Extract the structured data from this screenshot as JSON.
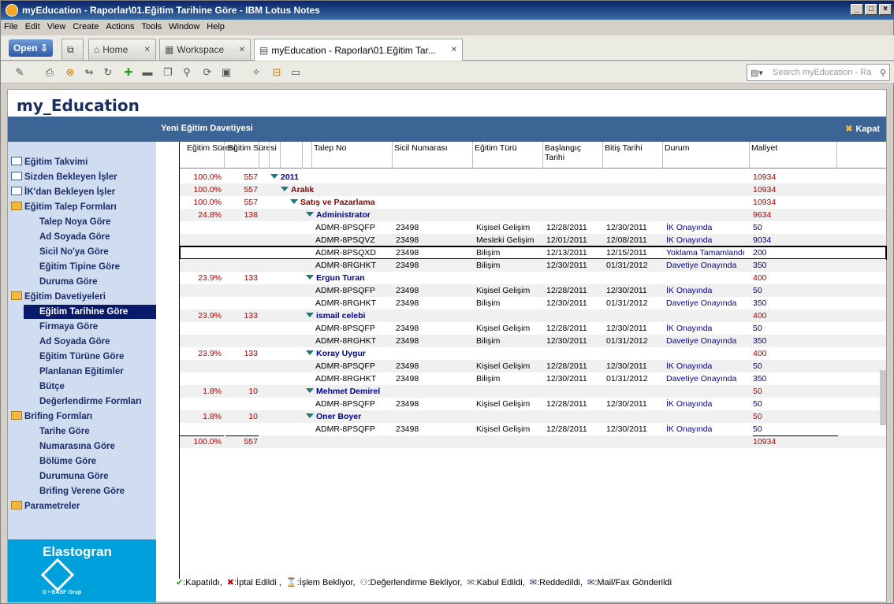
{
  "window": {
    "title": "myEducation - Raporlar\\01.Eğitim Tarihine Göre - IBM Lotus Notes",
    "controls": [
      "_",
      "□",
      "×"
    ]
  },
  "menu": [
    "File",
    "Edit",
    "View",
    "Create",
    "Actions",
    "Tools",
    "Window",
    "Help"
  ],
  "tabs": {
    "open": "Open",
    "home": "Home",
    "workspace": "Workspace",
    "active": "myEducation - Raporlar\\01.Eğitim Tar..."
  },
  "search": {
    "placeholder": "Search myEducation - Ra"
  },
  "app": {
    "title": "my_Education",
    "action_title": "Yeni Eğitim Davetiyesi",
    "close": "Kapat"
  },
  "sidebar": [
    {
      "label": "Eğitim Takvimi",
      "type": "table"
    },
    {
      "label": "Sizden Bekleyen İşler",
      "type": "table"
    },
    {
      "label": "İK'dan Bekleyen İşler",
      "type": "table"
    },
    {
      "label": "Eğitim Talep Formları",
      "type": "folder"
    },
    {
      "label": "Talep Noya Göre",
      "type": "sub"
    },
    {
      "label": "Ad Soyada Göre",
      "type": "sub"
    },
    {
      "label": "Sicil No'ya Göre",
      "type": "sub"
    },
    {
      "label": "Eğitim Tipine Göre",
      "type": "sub"
    },
    {
      "label": "Duruma Göre",
      "type": "sub"
    },
    {
      "label": "Eğitim Davetiyeleri",
      "type": "folder"
    },
    {
      "label": "Eğitim Tarihine Göre",
      "type": "selected"
    },
    {
      "label": "Firmaya Göre",
      "type": "sub"
    },
    {
      "label": "Ad Soyada Göre",
      "type": "sub"
    },
    {
      "label": "Eğitim Türüne Göre",
      "type": "sub"
    },
    {
      "label": "Planlanan Eğitimler",
      "type": "sub"
    },
    {
      "label": "Bütçe",
      "type": "sub"
    },
    {
      "label": "Değerlendirme Formları",
      "type": "sub"
    },
    {
      "label": "Brifing Formları",
      "type": "folder"
    },
    {
      "label": "Tarihe Göre",
      "type": "sub"
    },
    {
      "label": "Numarasına Göre",
      "type": "sub"
    },
    {
      "label": "Bölüme Göre",
      "type": "sub"
    },
    {
      "label": "Durumuna Göre",
      "type": "sub"
    },
    {
      "label": "Brifing Verene Göre",
      "type": "sub"
    },
    {
      "label": "Parametreler",
      "type": "folder"
    }
  ],
  "brand": {
    "name": "Elastogran",
    "group": "D • BASF Grup"
  },
  "columns": {
    "egitim_suresi_1": "Eğitim Süresi",
    "egitim_suresi_2": "Eğitim Süresi",
    "talep_no": "Talep No",
    "sicil": "Sicil Numarası",
    "egitim_turu": "Eğitim Türü",
    "baslangic": "Başlangıç Tarihi",
    "bitis": "Bitiş Tarihi",
    "durum": "Durum",
    "maliyet": "Maliyet"
  },
  "rows": [
    {
      "kind": "cat",
      "level": 0,
      "pct": "100.0%",
      "num": "557",
      "label": "2011",
      "cost": "10934"
    },
    {
      "kind": "cat",
      "level": 1,
      "pct": "100.0%",
      "num": "557",
      "label": "Aralık",
      "cost": "10934"
    },
    {
      "kind": "cat",
      "level": 2,
      "pct": "100.0%",
      "num": "557",
      "label": "Satış ve Pazarlama",
      "cost": "10934"
    },
    {
      "kind": "cat",
      "level": 3,
      "pct": "24.8%",
      "num": "138",
      "label": "Administrator",
      "cost": "9634"
    },
    {
      "kind": "doc",
      "talep": "ADMR-8PSQFP",
      "sicil": "23498",
      "tur": "Kişisel Gelişim",
      "bas": "12/28/2011",
      "bit": "12/30/2011",
      "durum": "İK Onayında",
      "cost": "50"
    },
    {
      "kind": "doc",
      "talep": "ADMR-8PSQVZ",
      "sicil": "23498",
      "tur": "Mesleki Gelişim",
      "bas": "12/01/2011",
      "bit": "12/08/2011",
      "durum": "İK Onayında",
      "cost": "9034"
    },
    {
      "kind": "doc",
      "talep": "ADMR-8PSQXD",
      "sicil": "23498",
      "tur": "Bilişim",
      "bas": "12/13/2011",
      "bit": "12/15/2011",
      "durum": "Yoklama Tamamlandı",
      "cost": "200",
      "selected": true
    },
    {
      "kind": "doc",
      "talep": "ADMR-8RGHKT",
      "sicil": "23498",
      "tur": "Bilişim",
      "bas": "12/30/2011",
      "bit": "01/31/2012",
      "durum": "Davetiye Onayında",
      "cost": "350"
    },
    {
      "kind": "cat",
      "level": 3,
      "pct": "23.9%",
      "num": "133",
      "label": "Ergun Turan",
      "cost": "400"
    },
    {
      "kind": "doc",
      "talep": "ADMR-8PSQFP",
      "sicil": "23498",
      "tur": "Kişisel Gelişim",
      "bas": "12/28/2011",
      "bit": "12/30/2011",
      "durum": "İK Onayında",
      "cost": "50"
    },
    {
      "kind": "doc",
      "talep": "ADMR-8RGHKT",
      "sicil": "23498",
      "tur": "Bilişim",
      "bas": "12/30/2011",
      "bit": "01/31/2012",
      "durum": "Davetiye Onayında",
      "cost": "350"
    },
    {
      "kind": "cat",
      "level": 3,
      "pct": "23.9%",
      "num": "133",
      "label": "ismail celebi",
      "cost": "400"
    },
    {
      "kind": "doc",
      "talep": "ADMR-8PSQFP",
      "sicil": "23498",
      "tur": "Kişisel Gelişim",
      "bas": "12/28/2011",
      "bit": "12/30/2011",
      "durum": "İK Onayında",
      "cost": "50"
    },
    {
      "kind": "doc",
      "talep": "ADMR-8RGHKT",
      "sicil": "23498",
      "tur": "Bilişim",
      "bas": "12/30/2011",
      "bit": "01/31/2012",
      "durum": "Davetiye Onayında",
      "cost": "350"
    },
    {
      "kind": "cat",
      "level": 3,
      "pct": "23.9%",
      "num": "133",
      "label": "Koray Uygur",
      "cost": "400"
    },
    {
      "kind": "doc",
      "talep": "ADMR-8PSQFP",
      "sicil": "23498",
      "tur": "Kişisel Gelişim",
      "bas": "12/28/2011",
      "bit": "12/30/2011",
      "durum": "İK Onayında",
      "cost": "50"
    },
    {
      "kind": "doc",
      "talep": "ADMR-8RGHKT",
      "sicil": "23498",
      "tur": "Bilişim",
      "bas": "12/30/2011",
      "bit": "01/31/2012",
      "durum": "Davetiye Onayında",
      "cost": "350"
    },
    {
      "kind": "cat",
      "level": 3,
      "pct": "1.8%",
      "num": "10",
      "label": "Mehmet Demirel",
      "cost": "50"
    },
    {
      "kind": "doc",
      "talep": "ADMR-8PSQFP",
      "sicil": "23498",
      "tur": "Kişisel Gelişim",
      "bas": "12/28/2011",
      "bit": "12/30/2011",
      "durum": "İK Onayında",
      "cost": "50"
    },
    {
      "kind": "cat",
      "level": 3,
      "pct": "1.8%",
      "num": "10",
      "label": "Oner Boyer",
      "cost": "50"
    },
    {
      "kind": "doc",
      "talep": "ADMR-8PSQFP",
      "sicil": "23498",
      "tur": "Kişisel Gelişim",
      "bas": "12/28/2011",
      "bit": "12/30/2011",
      "durum": "İK Onayında",
      "cost": "50"
    },
    {
      "kind": "total",
      "pct": "100.0%",
      "num": "557",
      "cost": "10934"
    }
  ],
  "legend": [
    {
      "icon": "✔",
      "color": "#2a9a2a",
      "label": ":Kapatıldı,"
    },
    {
      "icon": "✖",
      "color": "#c00000",
      "label": ":İptal Edildi ,"
    },
    {
      "icon": "⌛",
      "color": "#555555",
      "label": ":İşlem Bekliyor,"
    },
    {
      "icon": "⚇",
      "color": "#555555",
      "label": ":Değerlendirme Bekliyor,"
    },
    {
      "icon": "✉",
      "color": "#555555",
      "label": ":Kabul Edildi,"
    },
    {
      "icon": "✉",
      "color": "#1b2d6b",
      "label": ":Reddedildi,"
    },
    {
      "icon": "✉",
      "color": "#1b2d6b",
      "label": ":Mail/Fax Gönderildi"
    }
  ]
}
